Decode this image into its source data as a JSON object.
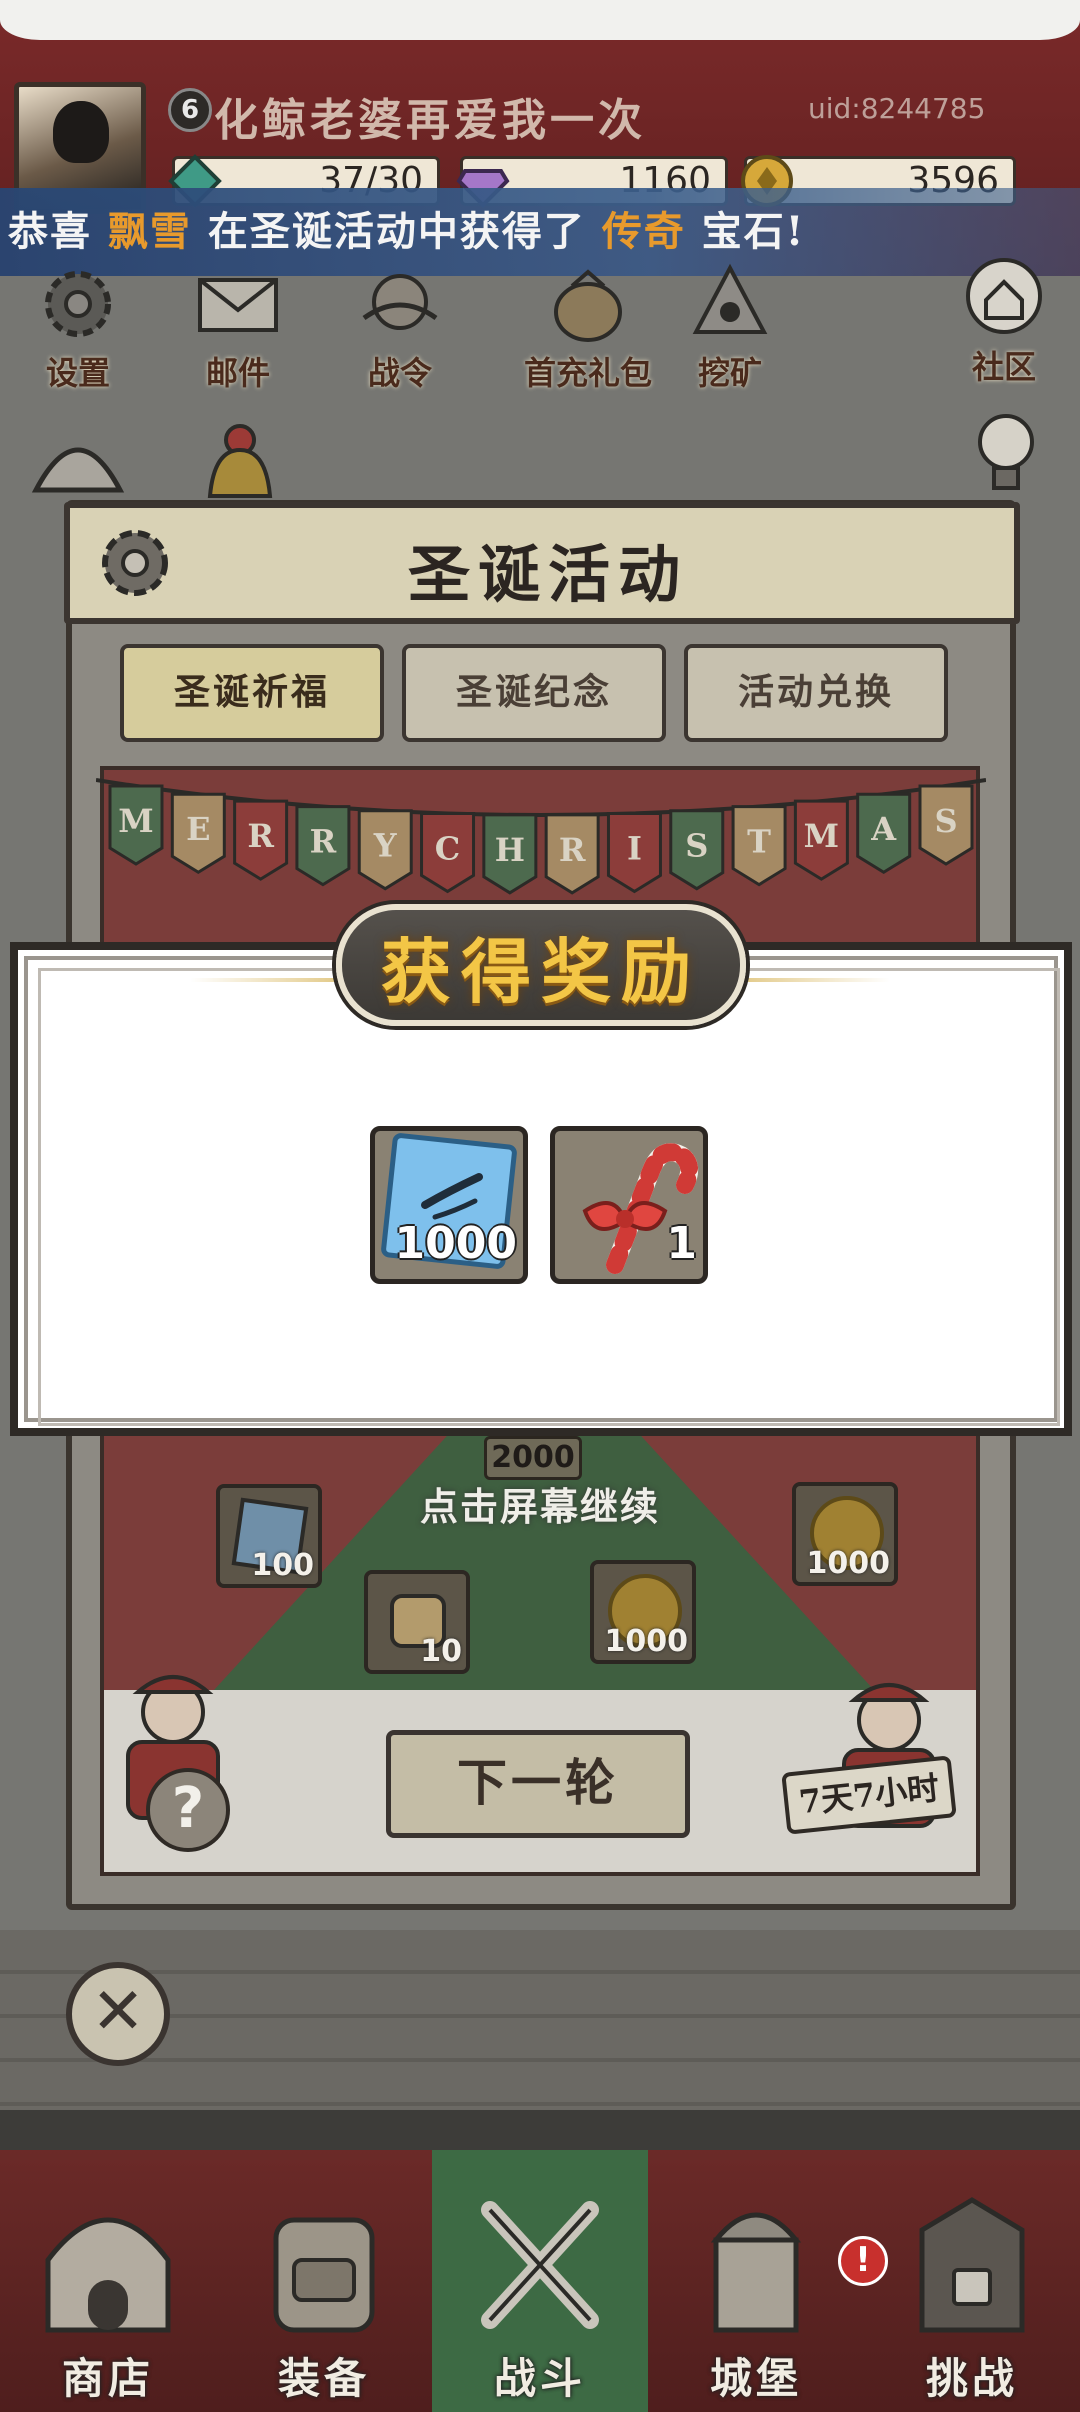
{
  "header": {
    "level": "6",
    "player_name": "化鲸老婆再爱我一次",
    "uid": "uid:8244785",
    "resources": {
      "energy": "37/30",
      "diamonds": "1160",
      "gold": "3596"
    }
  },
  "announcement": {
    "prefix": "恭喜",
    "player": "飘雪",
    "middle": "在圣诞活动中获得了",
    "rarity": "传奇",
    "suffix": "宝石!"
  },
  "menu": [
    {
      "label": "设置",
      "icon": "gear-icon"
    },
    {
      "label": "邮件",
      "icon": "envelope-icon"
    },
    {
      "label": "战令",
      "icon": "battle-pass-icon"
    },
    {
      "label": "首充礼包",
      "icon": "gift-bag-icon"
    },
    {
      "label": "挖矿",
      "icon": "mining-icon"
    },
    {
      "label": "社区",
      "icon": "home-icon"
    }
  ],
  "event_panel": {
    "title": "圣诞活动",
    "tabs": [
      "圣诞祈福",
      "圣诞纪念",
      "活动兑换"
    ],
    "banner": "MERRY CHRISTMAS",
    "scene_items": [
      {
        "qty": "100",
        "icon": "crystal-icon"
      },
      {
        "qty": "10",
        "icon": "scroll-icon"
      },
      {
        "qty": "1000",
        "icon": "gold-coin-icon"
      },
      {
        "qty": "1000",
        "icon": "gold-coin-icon"
      }
    ],
    "top_cost": "2000",
    "next_round": "下一轮",
    "timer": "7天7小时",
    "help": "?"
  },
  "reward_popup": {
    "title": "获得奖励",
    "hint": "点击屏幕继续",
    "items": [
      {
        "qty": "1000",
        "icon": "ice-crystal-icon"
      },
      {
        "qty": "1",
        "icon": "candy-cane-icon"
      }
    ]
  },
  "bottom_nav": [
    {
      "label": "商店",
      "icon": "shop-icon"
    },
    {
      "label": "装备",
      "icon": "backpack-icon"
    },
    {
      "label": "战斗",
      "icon": "crossed-swords-icon"
    },
    {
      "label": "城堡",
      "icon": "castle-icon"
    },
    {
      "label": "挑战",
      "icon": "challenge-icon"
    }
  ],
  "nav_alert": "!",
  "close": "✕",
  "colors": {
    "gold_text": "#f3c646",
    "highlight": "#e89a2c",
    "active_tab": "#3d6a44"
  }
}
